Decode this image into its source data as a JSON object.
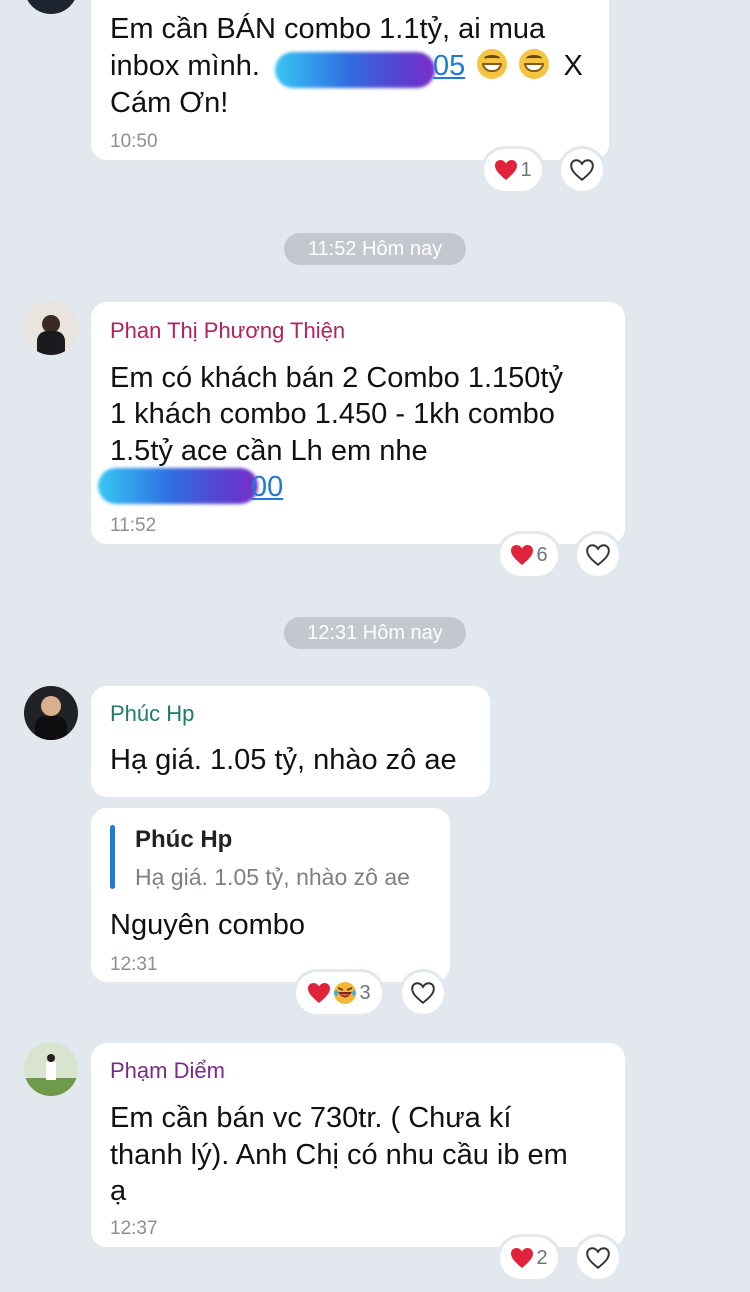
{
  "messages": [
    {
      "text_lines": [
        "Em cần BÁN combo 1.1tỷ, ai mua",
        "inbox mình."
      ],
      "phone_suffix": "05",
      "line3_tail": "X",
      "line4": "Cám Ơn!",
      "time": "10:50",
      "reaction_count": "1"
    },
    {
      "sender": "Phan Thị Phương Thiện",
      "text_lines": [
        "Em có khách bán 2 Combo 1.150tỷ",
        "1 khách combo 1.450 - 1kh combo",
        "1.5tỷ ace cần Lh em nhe"
      ],
      "phone_suffix": "00",
      "time": "11:52",
      "reaction_count": "6"
    },
    {
      "sender": "Phúc Hp",
      "text": "Hạ giá. 1.05 tỷ, nhào zô ae"
    },
    {
      "quote_sender": "Phúc Hp",
      "quote_text": "Hạ giá. 1.05 tỷ, nhào zô ae",
      "text": "Nguyên combo",
      "time": "12:31",
      "reaction_count": "3"
    },
    {
      "sender": "Phạm Diểm",
      "text_lines": [
        "Em cần bán vc 730tr. ( Chưa kí",
        "thanh lý). Anh Chị có nhu cầu ib em",
        "ạ"
      ],
      "time": "12:37",
      "reaction_count": "2"
    }
  ],
  "dividers": [
    "11:52 Hôm nay",
    "12:31 Hôm nay"
  ],
  "colors": {
    "background": "#e3e7ee",
    "sender_phan": "#b5205f",
    "sender_phuc": "#1e7a6a",
    "sender_pham": "#7a2a8a",
    "link": "#1f7ad8",
    "heart": "#e0223a"
  },
  "icons": [
    "heart-icon",
    "heart-outline-icon",
    "grin-emoji-icon",
    "laugh-cry-emoji-icon"
  ]
}
